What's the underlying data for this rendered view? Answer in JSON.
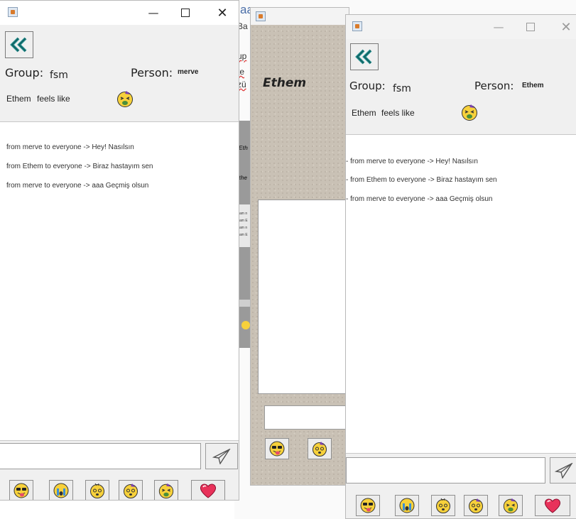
{
  "background_app": {
    "text_fragments": [
      "aa",
      "Ba",
      "up",
      "te",
      "zü"
    ],
    "strip_text": [
      "Eth",
      "the"
    ],
    "strip_lines": [
      "am n",
      "am E",
      "am n",
      "am E"
    ]
  },
  "middle_window": {
    "name": "Ethem"
  },
  "chat_windows": [
    {
      "group_label": "Group:",
      "group_value": "fsm",
      "person_label": "Person:",
      "person_value": "merve",
      "feels_name": "Ethem",
      "feels_text": "feels like",
      "mood_icon": "sick-face-emoji",
      "messages": [
        "from  merve   to everyone -> Hey! Nasılsın",
        "from  Ethem   to everyone -> Biraz hastayım sen",
        "from  merve   to everyone -> aaa Geçmiş olsun"
      ],
      "input_value": "",
      "emoji_buttons": [
        "tongue-sunglasses-emoji",
        "crying-emoji",
        "dizzy-emoji",
        "party-dizzy-emoji",
        "sick-face-emoji",
        "heart-emoji"
      ]
    },
    {
      "group_label": "Group:",
      "group_value": "fsm",
      "person_label": "Person:",
      "person_value": "Ethem",
      "feels_name": "Ethem",
      "feels_text": "feels like",
      "mood_icon": "sick-face-emoji",
      "messages": [
        "- from  merve   to everyone -> Hey! Nasılsın",
        "- from  Ethem   to everyone -> Biraz hastayım sen",
        "- from  merve   to everyone -> aaa Geçmiş olsun"
      ],
      "input_value": "",
      "emoji_buttons": [
        "tongue-sunglasses-emoji",
        "crying-emoji",
        "dizzy-emoji",
        "party-dizzy-emoji",
        "sick-face-emoji",
        "heart-emoji"
      ]
    }
  ],
  "colors": {
    "back_arrow": "#1f8a8a",
    "emoji_yellow": "#f7d13b",
    "heart": "#e8325a"
  }
}
